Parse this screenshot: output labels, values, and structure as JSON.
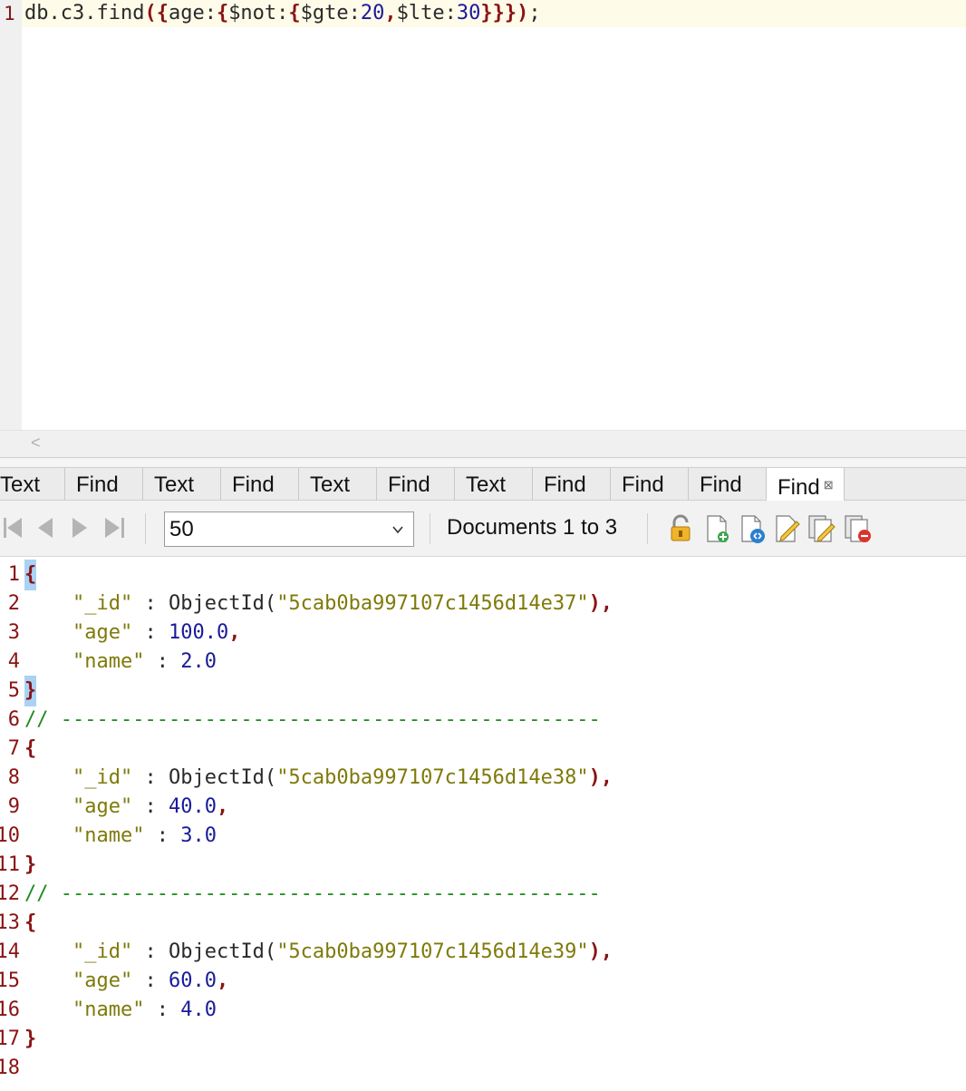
{
  "editor": {
    "line_number": "1",
    "query": {
      "t1": "db.c3.find",
      "t2": "({",
      "t3": "age:",
      "t4": "{",
      "t5": "$not:",
      "t6": "{",
      "t7": "$gte:",
      "t8": "20",
      "t9": ",",
      "t10": "$lte:",
      "t11": "30",
      "t12": "}}})",
      "t13": ";"
    }
  },
  "scrollbar": {
    "left_arrow": "<"
  },
  "tabs": [
    {
      "label": "Text"
    },
    {
      "label": "Find"
    },
    {
      "label": "Text"
    },
    {
      "label": "Find"
    },
    {
      "label": "Text"
    },
    {
      "label": "Find"
    },
    {
      "label": "Text"
    },
    {
      "label": "Find"
    },
    {
      "label": "Find"
    },
    {
      "label": "Find"
    },
    {
      "label": "Find",
      "close": "⊠"
    }
  ],
  "toolbar": {
    "page_size": "50",
    "documents_label": "Documents 1 to 3",
    "icons": [
      "first-page-icon",
      "previous-page-icon",
      "next-page-icon",
      "last-page-icon",
      "lock-icon",
      "add-document-icon",
      "view-document-icon",
      "edit-document-icon",
      "edit-documents-icon",
      "delete-documents-icon"
    ]
  },
  "results": {
    "line_numbers": [
      "1",
      "2",
      "3",
      "4",
      "5",
      "6",
      "7",
      "8",
      "9",
      "10",
      "11",
      "12",
      "13",
      "14",
      "15",
      "16",
      "17",
      "18"
    ],
    "documents": [
      {
        "id_key": "\"_id\"",
        "id_fn": "ObjectId(",
        "id_val": "\"5cab0ba997107c1456d14e37\"",
        "id_end": "),",
        "age_key": "\"age\"",
        "age_val": "100.0",
        "name_key": "\"name\"",
        "name_val": "2.0"
      },
      {
        "id_key": "\"_id\"",
        "id_fn": "ObjectId(",
        "id_val": "\"5cab0ba997107c1456d14e38\"",
        "id_end": "),",
        "age_key": "\"age\"",
        "age_val": "40.0",
        "name_key": "\"name\"",
        "name_val": "3.0"
      },
      {
        "id_key": "\"_id\"",
        "id_fn": "ObjectId(",
        "id_val": "\"5cab0ba997107c1456d14e39\"",
        "id_end": "),",
        "age_key": "\"age\"",
        "age_val": "60.0",
        "name_key": "\"name\"",
        "name_val": "4.0"
      }
    ],
    "separator": "// ---------------------------------------------",
    "open_brace": "{",
    "close_brace": "}",
    "colon": " : ",
    "comma": ","
  },
  "colors": {
    "bracket": "#8a1313",
    "number": "#1a1a9a",
    "string": "#7f7a0a",
    "comment": "#1f8a1f",
    "brace_highlight": "#a9d2f5"
  }
}
